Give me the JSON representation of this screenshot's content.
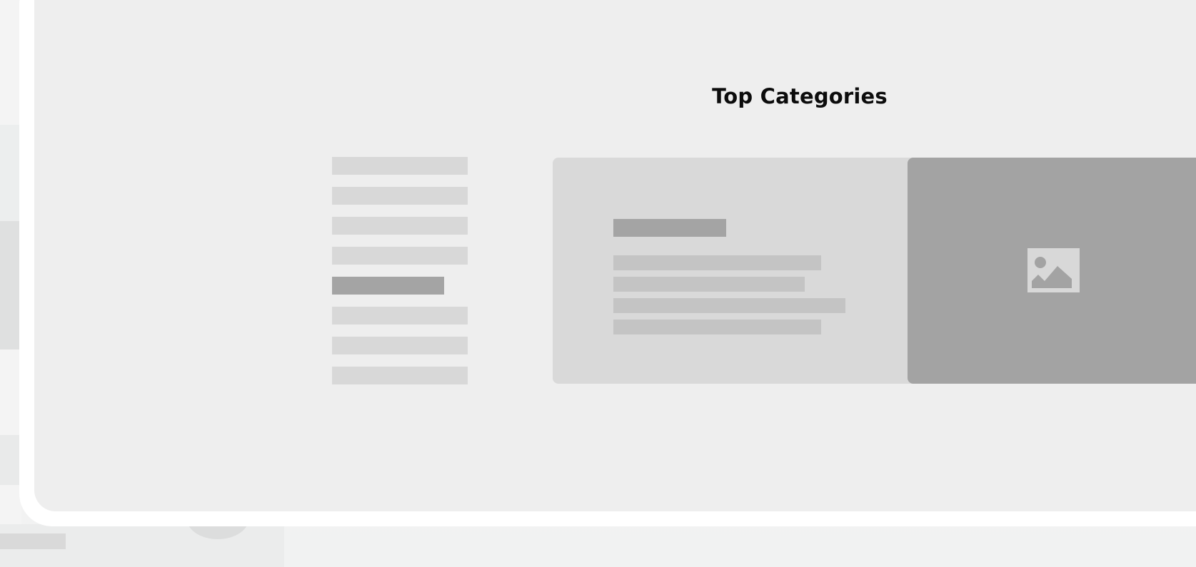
{
  "section": {
    "title": "Top Categories"
  },
  "categories": {
    "item_count": 8,
    "active_index": 4
  },
  "featured_card": {
    "image_icon": "image-placeholder-icon"
  },
  "colors": {
    "screen_bg": "#eeeeee",
    "placeholder_light": "#d8d8d8",
    "placeholder_dark": "#a4a4a4",
    "card_bg": "#d9d9d9",
    "card_line": "#c4c4c4",
    "image_bg": "#a3a3a3",
    "frame": "#ffffff"
  }
}
